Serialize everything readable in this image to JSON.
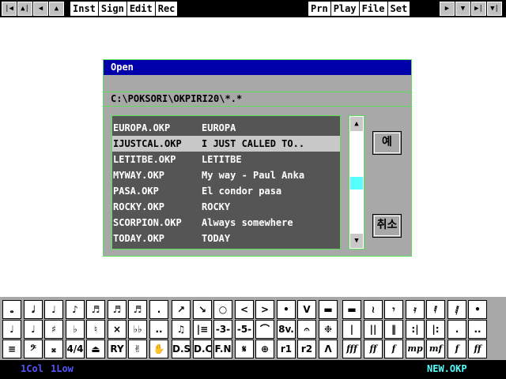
{
  "toolbar": {
    "left_nav": [
      "|◀",
      "▲|",
      "◀",
      "▲"
    ],
    "left_menu": [
      "Inst",
      "Sign",
      "Edit",
      "Rec"
    ],
    "right_menu": [
      "Prn",
      "Play",
      "File",
      "Set"
    ],
    "right_nav": [
      "▶",
      "▼",
      "▶|",
      "▼|"
    ]
  },
  "dialog": {
    "title": "Open",
    "path": "C:\\POKSORI\\OKPIRI20\\*.*",
    "files": [
      {
        "filename": "EUROPA.OKP",
        "title": "EUROPA",
        "selected": false
      },
      {
        "filename": "IJUSTCAL.OKP",
        "title": "I JUST CALLED TO..",
        "selected": true
      },
      {
        "filename": "LETITBE.OKP",
        "title": "LETITBE",
        "selected": false
      },
      {
        "filename": "MYWAY.OKP",
        "title": "My way - Paul Anka",
        "selected": false
      },
      {
        "filename": "PASA.OKP",
        "title": "El condor pasa",
        "selected": false
      },
      {
        "filename": "ROCKY.OKP",
        "title": "ROCKY",
        "selected": false
      },
      {
        "filename": "SCORPION.OKP",
        "title": "Always somewhere",
        "selected": false
      },
      {
        "filename": "TODAY.OKP",
        "title": "TODAY",
        "selected": false
      }
    ],
    "scroll_up": "▲",
    "scroll_down": "▼",
    "scroll_position": 0.5,
    "ok_label": "예",
    "cancel_label": "취소"
  },
  "palette": {
    "rows": [
      [
        "𝅝",
        "𝅗𝅥",
        "♩",
        "♪",
        "♬",
        "♬",
        "♬",
        ".",
        "↗",
        "↘",
        "○",
        "<",
        ">",
        "•",
        "V",
        "▬",
        "▬",
        "≀",
        "𝄾",
        "𝄿",
        "𝅀",
        "𝅁",
        "•"
      ],
      [
        "♩",
        "♩",
        "♯",
        "♭",
        "♮",
        "×",
        "♭♭",
        "..",
        "♫",
        "|≡",
        "-3-",
        "-5-",
        "⌒",
        "8v.",
        "𝄐",
        "❉",
        "|",
        "||",
        "‖",
        ":|",
        "|:",
        ".",
        ".."
      ],
      [
        "≡",
        "𝄢",
        "𝄪",
        "4/4",
        "⏏",
        "RY",
        "✌",
        "✋",
        "D.S",
        "D.C",
        "F.N",
        "𝄋",
        "⊕",
        "r1",
        "r2",
        "Λ",
        "fff",
        "ff",
        "f",
        "mp",
        "mf",
        "f",
        "ff",
        "fff"
      ]
    ]
  },
  "status": {
    "col": "1Col",
    "low": "1Low",
    "filename": "NEW.OKP"
  },
  "colors": {
    "title_bar": "#0000aa",
    "dialog_bg": "#a8a8a8",
    "list_bg": "#555555",
    "selection": "#c8c8c8",
    "frame": "#5be05b",
    "thumb": "#55ffff",
    "status_text": "#5555ff",
    "status_file": "#55ffff"
  }
}
